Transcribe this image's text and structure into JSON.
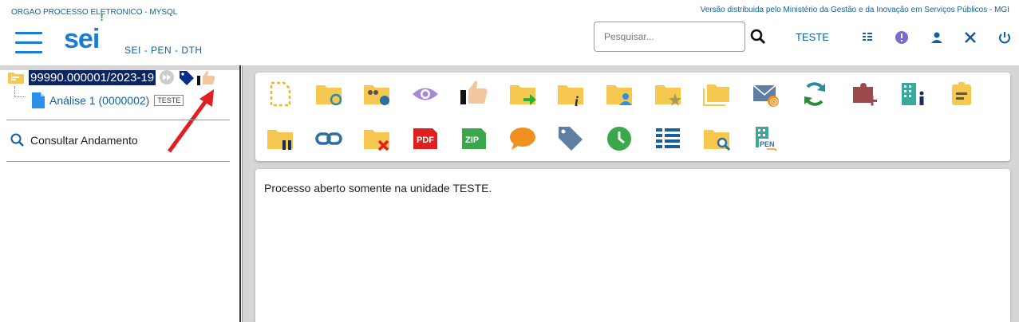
{
  "header": {
    "org_text": "ORGAO PROCESSO ELETRONICO - MYSQL",
    "version_text": "Versão distribuida pelo Ministério da Gestão e da Inovação em Serviços Públicos - MGI",
    "logo_text": "sei",
    "logo_mark": "!",
    "system_subtitle": "SEI - PEN - DTH",
    "search_placeholder": "Pesquisar...",
    "unit_label": "TESTE"
  },
  "tree": {
    "process_number": "99990.000001/2023-19",
    "document_label": "Análise 1 (0000002)",
    "document_badge": "TESTE"
  },
  "sidebar": {
    "consult_label": "Consultar Andamento"
  },
  "content": {
    "message": "Processo aberto somente na unidade TESTE."
  },
  "toolbar": {
    "row1": [
      "new-document-icon",
      "folder-sync-icon",
      "folder-users-settings-icon",
      "eye-icon",
      "thumbs-up-icon",
      "folder-send-icon",
      "folder-info-icon",
      "folder-user-icon",
      "folder-star-icon",
      "folders-icon",
      "email-icon",
      "refresh-icon",
      "puzzle-add-icon",
      "building-person-icon",
      "note-icon"
    ],
    "row2": [
      "folder-pause-icon",
      "link-icon",
      "folder-remove-icon",
      "pdf-icon",
      "zip-icon",
      "comment-icon",
      "tag-icon",
      "clock-icon",
      "list-icon",
      "folder-search-icon",
      "pen-icon"
    ],
    "pdf_text": "PDF",
    "zip_text": "ZIP",
    "pen_text": "PEN"
  },
  "colors": {
    "brand_blue": "#1a7bd6",
    "folder_yellow": "#f7c850",
    "selected_bg": "#0b2560"
  }
}
